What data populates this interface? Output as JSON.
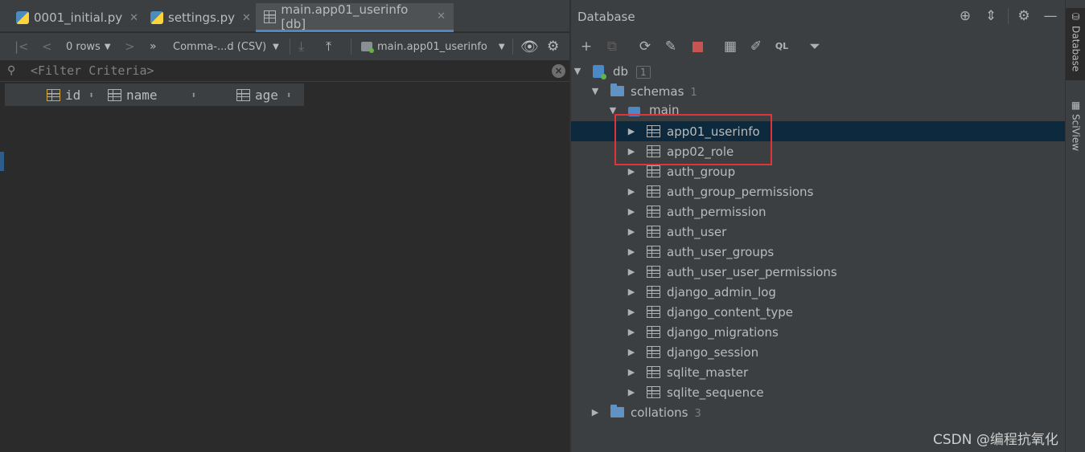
{
  "tabs": [
    {
      "label": "0001_initial.py",
      "icon": "python-file-icon",
      "active": false
    },
    {
      "label": "settings.py",
      "icon": "python-file-icon",
      "active": false
    },
    {
      "label": "main.app01_userinfo [db]",
      "icon": "table-icon",
      "active": true
    }
  ],
  "toolbar": {
    "rows_label": "0 rows",
    "export_format": "Comma-...d (CSV)",
    "datasource": "main.app01_userinfo"
  },
  "filter": {
    "placeholder": "<Filter Criteria>"
  },
  "columns": [
    {
      "name": "id",
      "icon": "primary-key-column-icon"
    },
    {
      "name": "name",
      "icon": "column-icon"
    },
    {
      "name": "age",
      "icon": "column-icon"
    }
  ],
  "database_panel": {
    "title": "Database",
    "tree": {
      "db": {
        "label": "db",
        "count": "1"
      },
      "schemas": {
        "label": "schemas",
        "count": "1"
      },
      "main": {
        "label": "main"
      },
      "tables": [
        "app01_userinfo",
        "app02_role",
        "auth_group",
        "auth_group_permissions",
        "auth_permission",
        "auth_user",
        "auth_user_groups",
        "auth_user_user_permissions",
        "django_admin_log",
        "django_content_type",
        "django_migrations",
        "django_session",
        "sqlite_master",
        "sqlite_sequence"
      ],
      "selected_table": "app01_userinfo",
      "collations": {
        "label": "collations",
        "count": "3"
      }
    }
  },
  "side_strip": {
    "database_tab": "Database",
    "sciview_tab": "SciView"
  },
  "watermark": "CSDN @编程抗氧化",
  "colors": {
    "selection": "#0d293e",
    "highlight_box": "#e0343b",
    "accent": "#4a88c7"
  }
}
